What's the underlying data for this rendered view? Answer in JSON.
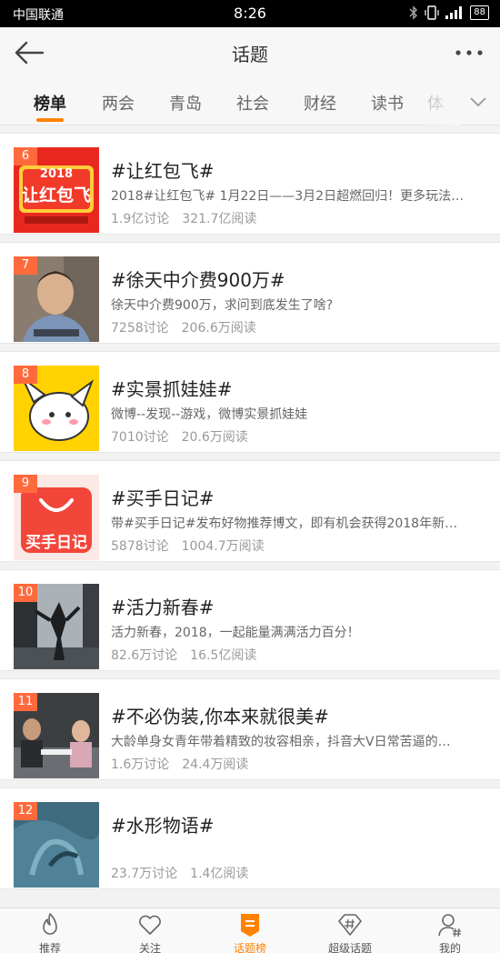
{
  "status_bar": {
    "carrier": "中国联通",
    "time": "8:26",
    "battery": "88"
  },
  "header": {
    "title": "话题",
    "back_icon": "back-arrow-icon",
    "more_icon": "more-dots-icon"
  },
  "tabs": [
    {
      "label": "榜单",
      "active": true
    },
    {
      "label": "两会"
    },
    {
      "label": "青岛"
    },
    {
      "label": "社会"
    },
    {
      "label": "财经"
    },
    {
      "label": "读书"
    },
    {
      "label": "体"
    }
  ],
  "topics": [
    {
      "rank": "6",
      "title": "#让红包飞#",
      "desc": "2018#让红包飞# 1月22日——3月2日超燃回归！更多玩法…",
      "discussions": "1.9亿讨论",
      "reads": "321.7亿阅读",
      "thumb_text": [
        "2018",
        "让红包飞"
      ]
    },
    {
      "rank": "7",
      "title": "#徐天中介费900万#",
      "desc": "徐天中介费900万，求问到底发生了啥?",
      "discussions": "7258讨论",
      "reads": "206.6万阅读"
    },
    {
      "rank": "8",
      "title": "#实景抓娃娃#",
      "desc": "微博--发现--游戏，微博实景抓娃娃",
      "discussions": "7010讨论",
      "reads": "20.6万阅读"
    },
    {
      "rank": "9",
      "title": "#买手日记#",
      "desc": "带#买手日记#发布好物推荐博文，即有机会获得2018年新…",
      "discussions": "5878讨论",
      "reads": "1004.7万阅读",
      "thumb_text": [
        "买手日记"
      ]
    },
    {
      "rank": "10",
      "title": "#活力新春#",
      "desc": "活力新春，2018，一起能量满满活力百分！",
      "discussions": "82.6万讨论",
      "reads": "16.5亿阅读"
    },
    {
      "rank": "11",
      "title": "#不必伪装,你本来就很美#",
      "desc": "大龄单身女青年带着精致的妆容相亲，抖音大V日常苦逼的…",
      "discussions": "1.6万讨论",
      "reads": "24.4万阅读"
    },
    {
      "rank": "12",
      "title": "#水形物语#",
      "desc": "",
      "discussions": "23.7万讨论",
      "reads": "1.4亿阅读"
    }
  ],
  "bottom_nav": [
    {
      "label": "推荐",
      "icon": "flame-icon"
    },
    {
      "label": "关注",
      "icon": "heart-icon"
    },
    {
      "label": "话题榜",
      "icon": "topic-list-icon",
      "active": true
    },
    {
      "label": "超级话题",
      "icon": "hashtag-diamond-icon"
    },
    {
      "label": "我的",
      "icon": "user-hashtag-icon"
    }
  ],
  "colors": {
    "accent": "#ff8200",
    "rank_badge": "#ff6a3d"
  }
}
